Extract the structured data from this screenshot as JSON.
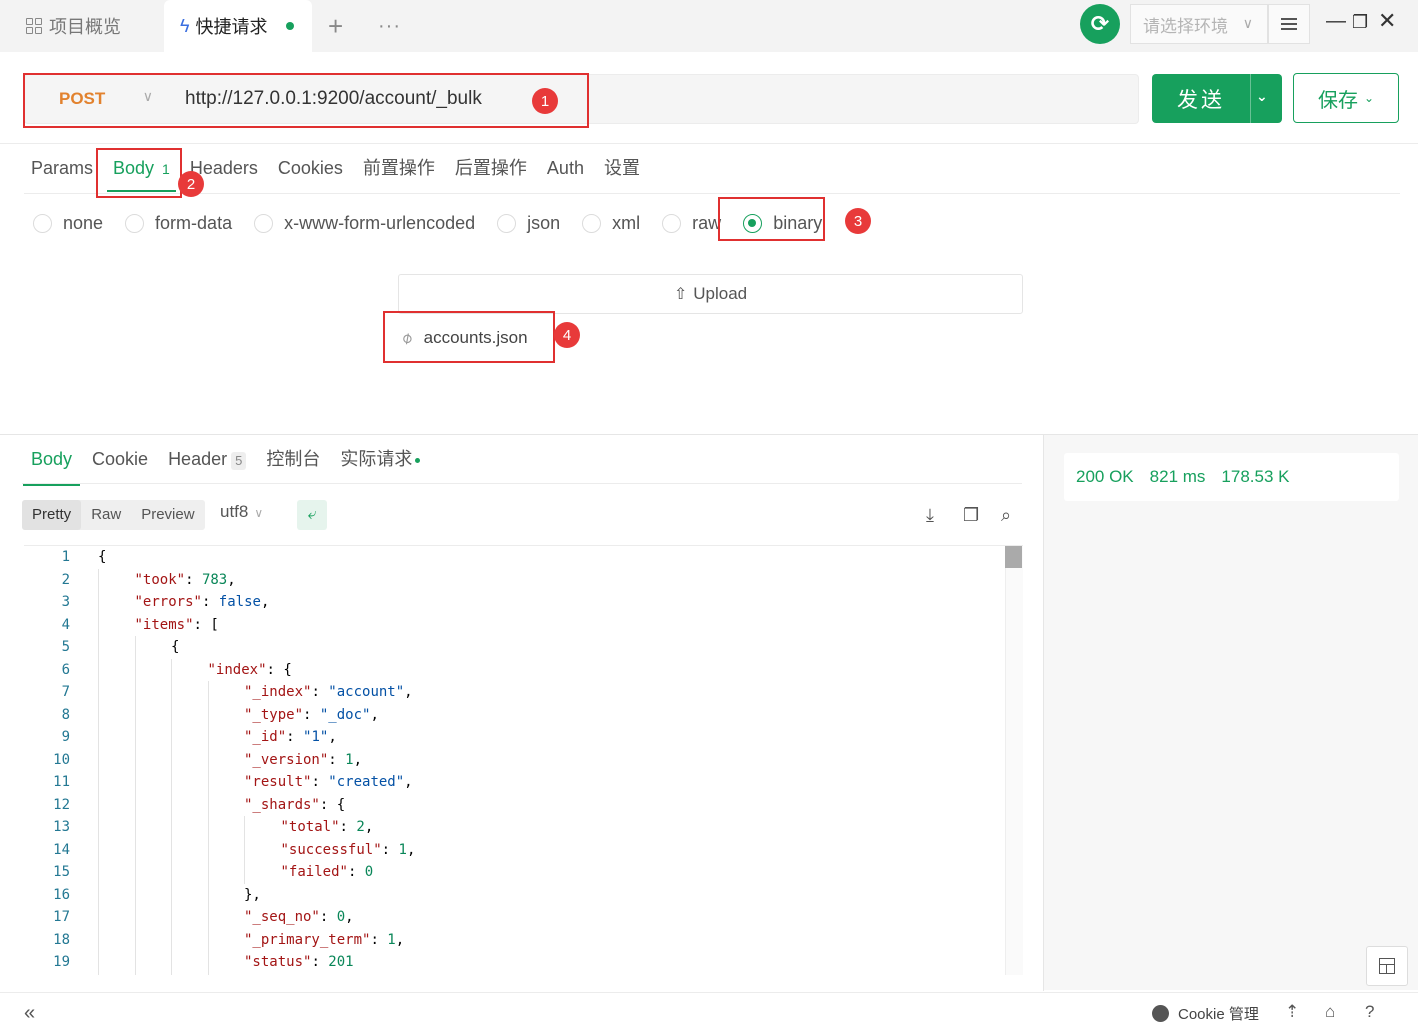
{
  "tabs": {
    "overview": "项目概览",
    "quick_request": "快捷请求",
    "plus": "+",
    "more": "···"
  },
  "env": {
    "placeholder": "请选择环境"
  },
  "request": {
    "method": "POST",
    "url": "http://127.0.0.1:9200/account/_bulk",
    "send_label": "发送",
    "save_label": "保存"
  },
  "req_tabs": [
    {
      "label": "Params"
    },
    {
      "label": "Body",
      "count": "1"
    },
    {
      "label": "Headers"
    },
    {
      "label": "Cookies"
    },
    {
      "label": "前置操作"
    },
    {
      "label": "后置操作"
    },
    {
      "label": "Auth"
    },
    {
      "label": "设置"
    }
  ],
  "body_types": [
    "none",
    "form-data",
    "x-www-form-urlencoded",
    "json",
    "xml",
    "raw",
    "binary"
  ],
  "body_selected": "binary",
  "upload": {
    "label": "Upload",
    "file_name": "accounts.json"
  },
  "annotations": [
    "1",
    "2",
    "3",
    "4"
  ],
  "response": {
    "tabs": [
      {
        "label": "Body"
      },
      {
        "label": "Cookie"
      },
      {
        "label": "Header",
        "count": "5"
      },
      {
        "label": "控制台"
      },
      {
        "label": "实际请求"
      }
    ],
    "view_modes": [
      "Pretty",
      "Raw",
      "Preview"
    ],
    "encoding": "utf8",
    "status": "200 OK",
    "time": "821 ms",
    "size": "178.53 K"
  },
  "code_lines": [
    {
      "n": "1",
      "indent": 0,
      "parts": [
        [
          "p",
          "{"
        ]
      ]
    },
    {
      "n": "2",
      "indent": 1,
      "parts": [
        [
          "k",
          "\"took\""
        ],
        [
          "p",
          ": "
        ],
        [
          "n",
          "783"
        ],
        [
          "p",
          ","
        ]
      ]
    },
    {
      "n": "3",
      "indent": 1,
      "parts": [
        [
          "k",
          "\"errors\""
        ],
        [
          "p",
          ": "
        ],
        [
          "b",
          "false"
        ],
        [
          "p",
          ","
        ]
      ]
    },
    {
      "n": "4",
      "indent": 1,
      "parts": [
        [
          "k",
          "\"items\""
        ],
        [
          "p",
          ": ["
        ]
      ]
    },
    {
      "n": "5",
      "indent": 2,
      "parts": [
        [
          "p",
          "{"
        ]
      ]
    },
    {
      "n": "6",
      "indent": 3,
      "parts": [
        [
          "k",
          "\"index\""
        ],
        [
          "p",
          ": {"
        ]
      ]
    },
    {
      "n": "7",
      "indent": 4,
      "parts": [
        [
          "k",
          "\"_index\""
        ],
        [
          "p",
          ": "
        ],
        [
          "s",
          "\"account\""
        ],
        [
          "p",
          ","
        ]
      ]
    },
    {
      "n": "8",
      "indent": 4,
      "parts": [
        [
          "k",
          "\"_type\""
        ],
        [
          "p",
          ": "
        ],
        [
          "s",
          "\"_doc\""
        ],
        [
          "p",
          ","
        ]
      ]
    },
    {
      "n": "9",
      "indent": 4,
      "parts": [
        [
          "k",
          "\"_id\""
        ],
        [
          "p",
          ": "
        ],
        [
          "s",
          "\"1\""
        ],
        [
          "p",
          ","
        ]
      ]
    },
    {
      "n": "10",
      "indent": 4,
      "parts": [
        [
          "k",
          "\"_version\""
        ],
        [
          "p",
          ": "
        ],
        [
          "n",
          "1"
        ],
        [
          "p",
          ","
        ]
      ]
    },
    {
      "n": "11",
      "indent": 4,
      "parts": [
        [
          "k",
          "\"result\""
        ],
        [
          "p",
          ": "
        ],
        [
          "s",
          "\"created\""
        ],
        [
          "p",
          ","
        ]
      ]
    },
    {
      "n": "12",
      "indent": 4,
      "parts": [
        [
          "k",
          "\"_shards\""
        ],
        [
          "p",
          ": {"
        ]
      ]
    },
    {
      "n": "13",
      "indent": 5,
      "parts": [
        [
          "k",
          "\"total\""
        ],
        [
          "p",
          ": "
        ],
        [
          "n",
          "2"
        ],
        [
          "p",
          ","
        ]
      ]
    },
    {
      "n": "14",
      "indent": 5,
      "parts": [
        [
          "k",
          "\"successful\""
        ],
        [
          "p",
          ": "
        ],
        [
          "n",
          "1"
        ],
        [
          "p",
          ","
        ]
      ]
    },
    {
      "n": "15",
      "indent": 5,
      "parts": [
        [
          "k",
          "\"failed\""
        ],
        [
          "p",
          ": "
        ],
        [
          "n",
          "0"
        ]
      ]
    },
    {
      "n": "16",
      "indent": 4,
      "parts": [
        [
          "p",
          "},"
        ]
      ]
    },
    {
      "n": "17",
      "indent": 4,
      "parts": [
        [
          "k",
          "\"_seq_no\""
        ],
        [
          "p",
          ": "
        ],
        [
          "n",
          "0"
        ],
        [
          "p",
          ","
        ]
      ]
    },
    {
      "n": "18",
      "indent": 4,
      "parts": [
        [
          "k",
          "\"_primary_term\""
        ],
        [
          "p",
          ": "
        ],
        [
          "n",
          "1"
        ],
        [
          "p",
          ","
        ]
      ]
    },
    {
      "n": "19",
      "indent": 4,
      "parts": [
        [
          "k",
          "\"status\""
        ],
        [
          "p",
          ": "
        ],
        [
          "n",
          "201"
        ]
      ]
    }
  ],
  "footer": {
    "cookie_label": "Cookie 管理"
  },
  "icons": {
    "overview": "grid-icon",
    "quick": "bolt-icon",
    "sync": "sync-icon",
    "upload": "upload-icon",
    "file": "paperclip-icon"
  },
  "colors": {
    "accent": "#17a05d",
    "method": "#e2822e",
    "annotation": "#e03030"
  }
}
